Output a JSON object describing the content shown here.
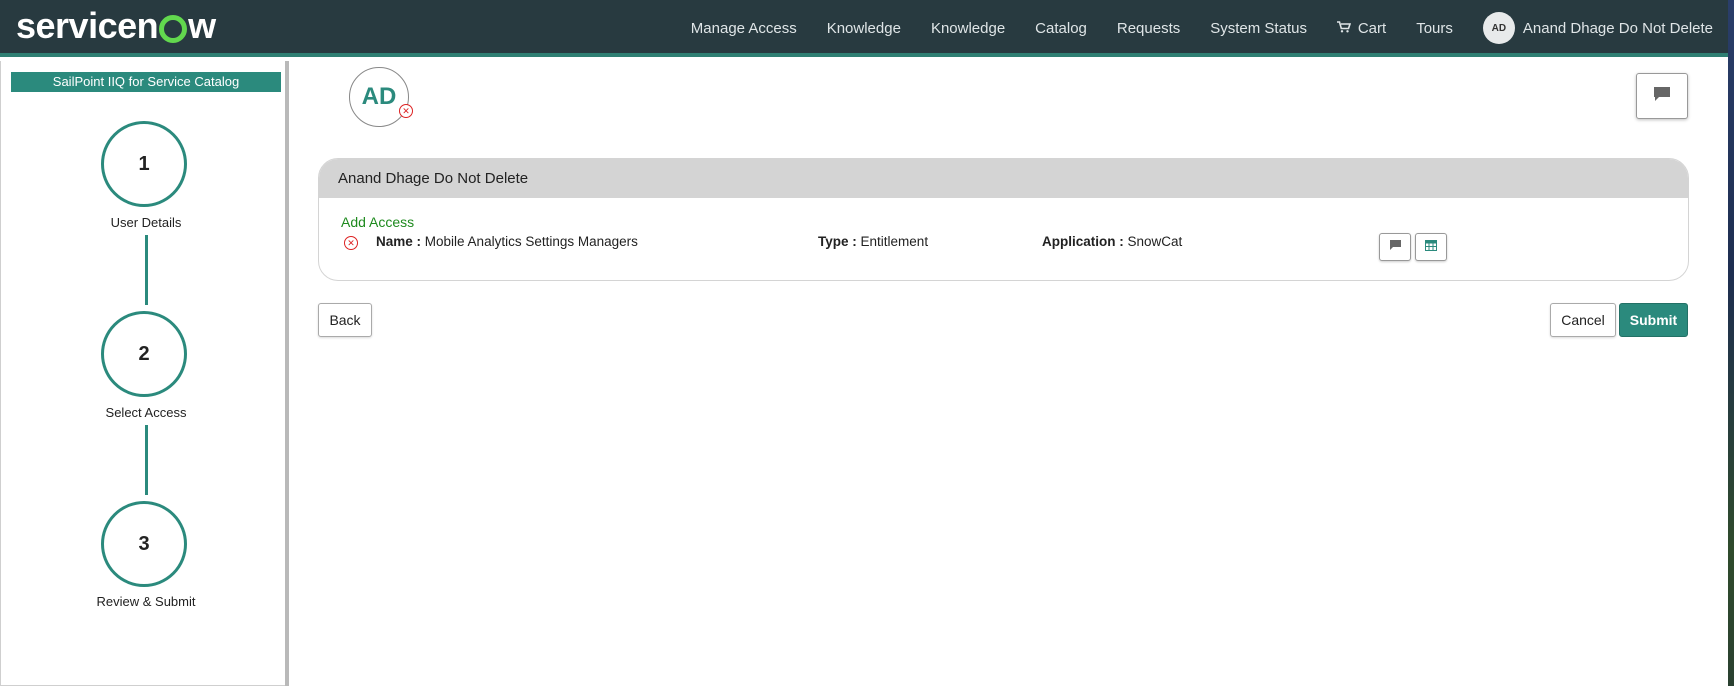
{
  "brand": {
    "logo_text_left": "servicen",
    "logo_text_right": "w"
  },
  "nav": {
    "items": [
      "Manage Access",
      "Knowledge",
      "Knowledge",
      "Catalog",
      "Requests",
      "System Status"
    ],
    "cart_label": "Cart",
    "tours_label": "Tours",
    "user_initials": "AD",
    "user_name": "Anand Dhage Do Not Delete"
  },
  "sidebar": {
    "catalog_label": "SailPoint IIQ for Service Catalog",
    "steps": [
      {
        "number": "1",
        "label": "User Details"
      },
      {
        "number": "2",
        "label": "Select Access"
      },
      {
        "number": "3",
        "label": "Review & Submit"
      }
    ]
  },
  "main": {
    "user_initials": "AD",
    "panel_title": "Anand Dhage Do Not Delete",
    "section_label": "Add Access",
    "item": {
      "name_label": "Name :",
      "name_value": "Mobile Analytics Settings Managers",
      "type_label": "Type :",
      "type_value": "Entitlement",
      "application_label": "Application :",
      "application_value": "SnowCat"
    },
    "back_label": "Back",
    "cancel_label": "Cancel",
    "submit_label": "Submit"
  },
  "colors": {
    "nav_bg": "#283a40",
    "accent": "#2b8a7d",
    "add_access": "#1e8a1e",
    "remove": "#dd2222"
  },
  "icons": [
    "comment-icon",
    "calendar-icon",
    "remove-icon",
    "cart-icon"
  ]
}
